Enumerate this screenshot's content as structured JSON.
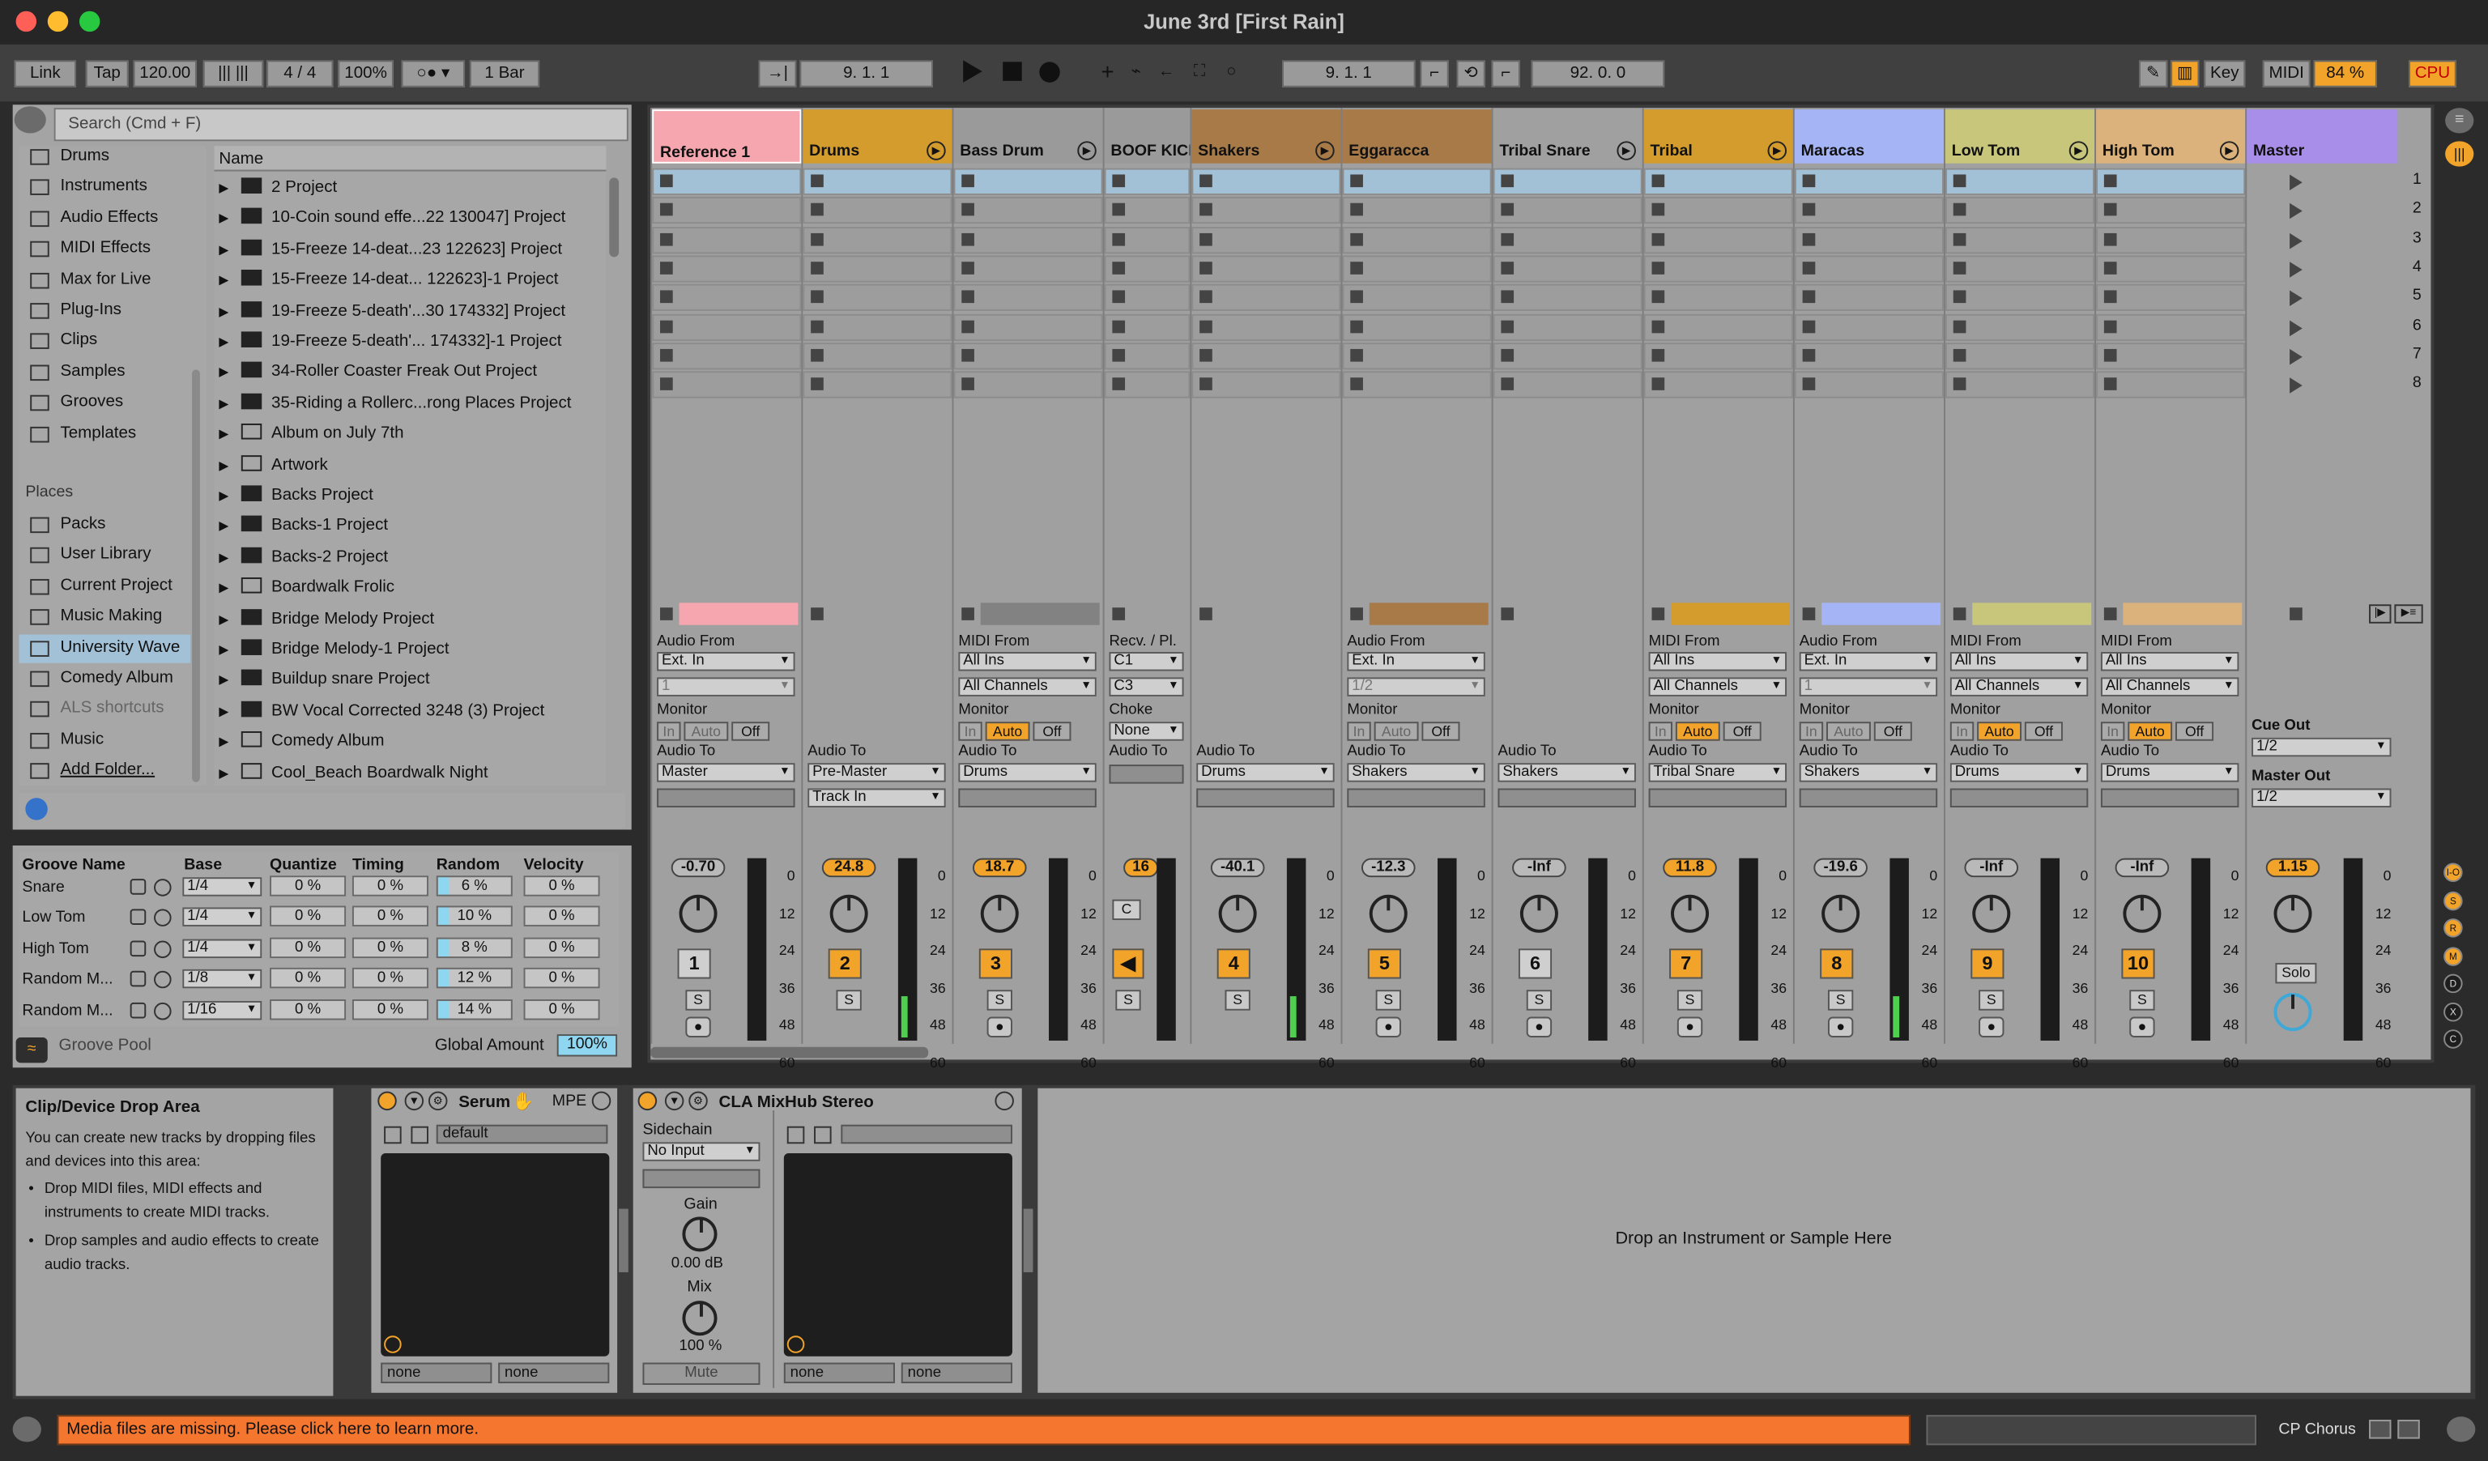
{
  "window": {
    "title": "June 3rd  [First Rain]"
  },
  "transport": {
    "link": "Link",
    "tap": "Tap",
    "tempo": "120.00",
    "signature": "4 / 4",
    "zoom": "100%",
    "quant": "1 Bar",
    "position": "9.  1.  1",
    "loop_start": "9.  1.  1",
    "loop_length": "92.  0.  0",
    "key": "Key",
    "midi": "MIDI",
    "cpu_value": "84 %",
    "cpu": "CPU"
  },
  "browser": {
    "search_placeholder": "Search (Cmd + F)",
    "categories": [
      "Drums",
      "Instruments",
      "Audio Effects",
      "MIDI Effects",
      "Max for Live",
      "Plug-Ins",
      "Clips",
      "Samples",
      "Grooves",
      "Templates"
    ],
    "places_title": "Places",
    "places": [
      "Packs",
      "User Library",
      "Current Project",
      "Music Making",
      "University Wave",
      "Comedy Album",
      "ALS shortcuts",
      "Music",
      "Add Folder..."
    ],
    "name_header": "Name",
    "items": [
      "2 Project",
      "10-Coin sound effe...22 130047] Project",
      "15-Freeze 14-deat...23 122623] Project",
      "15-Freeze 14-deat... 122623]-1 Project",
      "19-Freeze 5-death'...30 174332] Project",
      "19-Freeze 5-death'... 174332]-1 Project",
      "34-Roller Coaster Freak Out Project",
      "35-Riding a Rollerc...rong Places Project",
      "Album on July 7th",
      "Artwork",
      "Backs Project",
      "Backs-1 Project",
      "Backs-2 Project",
      "Boardwalk Frolic",
      "Bridge Melody Project",
      "Bridge Melody-1 Project",
      "Buildup snare Project",
      "BW Vocal Corrected 3248 (3) Project",
      "Comedy Album",
      "Cool_Beach Boardwalk Night"
    ]
  },
  "groove": {
    "headers": [
      "Groove Name",
      "Base",
      "Quantize",
      "Timing",
      "Random",
      "Velocity"
    ],
    "rows": [
      {
        "name": "Snare",
        "base": "1/4",
        "q": "0 %",
        "t": "0 %",
        "r": "6 %",
        "v": "0 %"
      },
      {
        "name": "Low Tom",
        "base": "1/4",
        "q": "0 %",
        "t": "0 %",
        "r": "10 %",
        "v": "0 %"
      },
      {
        "name": "High Tom",
        "base": "1/4",
        "q": "0 %",
        "t": "0 %",
        "r": "8 %",
        "v": "0 %"
      },
      {
        "name": "Random M...",
        "base": "1/8",
        "q": "0 %",
        "t": "0 %",
        "r": "12 %",
        "v": "0 %"
      },
      {
        "name": "Random M...",
        "base": "1/16",
        "q": "0 %",
        "t": "0 %",
        "r": "14 %",
        "v": "0 %"
      }
    ],
    "pool": "Groove Pool",
    "global_label": "Global Amount",
    "global_value": "100%"
  },
  "tracks": [
    {
      "name": "Reference 1",
      "color": "#f5a6ae",
      "num": "",
      "vol": "-0.70",
      "io_title": "Audio From",
      "io": "Ext. In",
      "ch": "1",
      "monitor": true,
      "mon": "Off",
      "to": "Master"
    },
    {
      "name": "Drums",
      "color": "#d39c2d",
      "num": "2",
      "vol": "24.8",
      "to": "Pre-Master",
      "to2": "Track In"
    },
    {
      "name": "Bass Drum",
      "color": "#9a9a9a",
      "num": "3",
      "vol": "18.7",
      "io_title": "MIDI From",
      "io": "All Ins",
      "ch": "All Channels",
      "monitor": true,
      "mon": "Auto",
      "to": "Drums"
    },
    {
      "name": "BOOF KICK",
      "color": "#9a9a9a",
      "num": "",
      "vol": "16",
      "io_title": "Recv. / Pl.",
      "io": "C1",
      "ch": "C3",
      "choke": "None"
    },
    {
      "name": "Shakers",
      "color": "#a87a48",
      "num": "4",
      "vol": "-40.1",
      "to": "Drums"
    },
    {
      "name": "Eggaracca",
      "color": "#a87a48",
      "num": "5",
      "vol": "-12.3",
      "io_title": "Audio From",
      "io": "Ext. In",
      "ch": "1/2",
      "monitor": true,
      "mon": "Off",
      "to": "Shakers"
    },
    {
      "name": "Tribal Snare",
      "color": "#a0a0a0",
      "num": "6",
      "vol": "-Inf",
      "to": "Shakers"
    },
    {
      "name": "Tribal",
      "color": "#d39c2d",
      "num": "7",
      "vol": "11.8",
      "io_title": "MIDI From",
      "io": "All Ins",
      "ch": "All Channels",
      "monitor": true,
      "mon": "Auto",
      "to": "Tribal Snare"
    },
    {
      "name": "Maracas",
      "color": "#a5b4f5",
      "num": "8",
      "vol": "-19.6",
      "io_title": "Audio From",
      "io": "Ext. In",
      "ch": "1",
      "monitor": true,
      "mon": "Off",
      "to": "Shakers"
    },
    {
      "name": "Low Tom",
      "color": "#c7c67b",
      "num": "9",
      "vol": "-Inf",
      "io_title": "MIDI From",
      "io": "All Ins",
      "ch": "All Channels",
      "monitor": true,
      "mon": "Auto",
      "to": "Drums"
    },
    {
      "name": "High Tom",
      "color": "#dcb27c",
      "num": "10",
      "vol": "-Inf",
      "io_title": "MIDI From",
      "io": "All Ins",
      "ch": "All Channels",
      "monitor": true,
      "mon": "Auto",
      "to": "Drums"
    },
    {
      "name": "Master",
      "color": "#a88ee8",
      "num": "",
      "vol": "1.15",
      "cue_label": "Cue Out",
      "cue": "1/2",
      "master_label": "Master Out",
      "master": "1/2",
      "solo": "Solo"
    }
  ],
  "io_labels": {
    "monitor": "Monitor",
    "audio_to": "Audio To",
    "choke": "Choke",
    "in": "In",
    "auto": "Auto",
    "off": "Off",
    "solo": "S"
  },
  "scenes": [
    "1",
    "2",
    "3",
    "4",
    "5",
    "6",
    "7",
    "8"
  ],
  "meter_scale": [
    "0",
    "12",
    "24",
    "36",
    "48",
    "60"
  ],
  "device": {
    "drop_title": "Clip/Device Drop Area",
    "drop_text": "You can create new tracks by dropping files and devices into this area:",
    "bullet1": "Drop MIDI files, MIDI effects and instruments to create MIDI tracks.",
    "bullet2": "Drop samples and audio effects to create audio tracks.",
    "serum": "Serum",
    "mpe": "MPE",
    "preset": "default",
    "none": "none",
    "mixhub": "CLA MixHub Stereo",
    "sidechain": "Sidechain",
    "no_input": "No Input",
    "gain": "Gain",
    "gain_val": "0.00 dB",
    "mix": "Mix",
    "mix_val": "100 %",
    "mute": "Mute",
    "drop_instrument": "Drop an Instrument or Sample Here"
  },
  "status": {
    "message": "Media files are missing. Please click here to learn more.",
    "plugin": "CP Chorus"
  },
  "colors": {
    "accent": "#f1a32a",
    "status": "#f5772f",
    "selection": "#a3c1d6"
  }
}
